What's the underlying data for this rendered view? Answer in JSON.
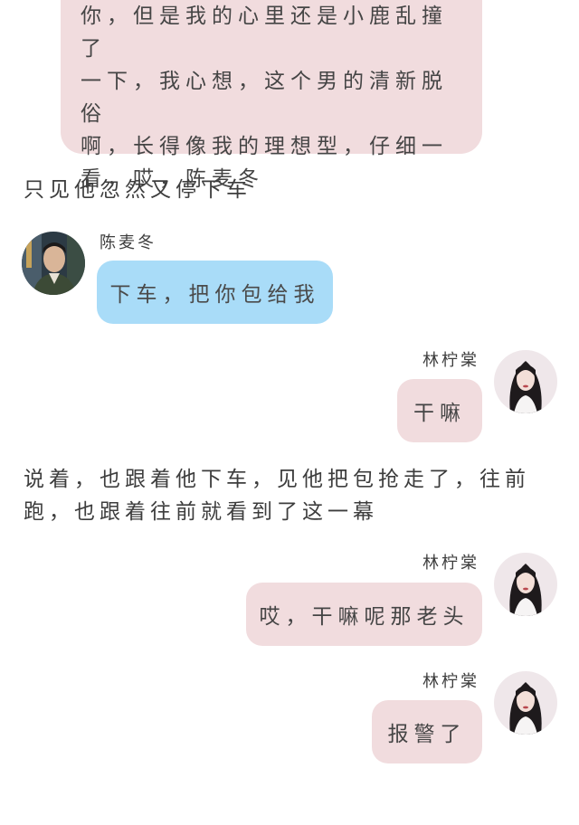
{
  "top_message": {
    "lines": [
      "你，但是我的心里还是小鹿乱撞了",
      "一下，我心想，这个男的清新脱俗",
      "啊，长得像我的理想型，仔细一",
      "看，哎，陈麦冬"
    ]
  },
  "narration_1": "只见他忽然又停下车",
  "message_1": {
    "sender": "陈麦冬",
    "text": "下车，把你包给我",
    "bubble_color": "#a9dcf8"
  },
  "message_2": {
    "sender": "林柠棠",
    "text": "干嘛",
    "bubble_color": "#f1dcde"
  },
  "narration_2": {
    "lines": [
      "说着，也跟着他下车，见他把包抢走了，往前",
      "跑，也跟着往前就看到了这一幕"
    ]
  },
  "message_3": {
    "sender": "林柠棠",
    "text": "哎，干嘛呢那老头"
  },
  "message_4": {
    "sender": "林柠棠",
    "text": "报警了"
  }
}
